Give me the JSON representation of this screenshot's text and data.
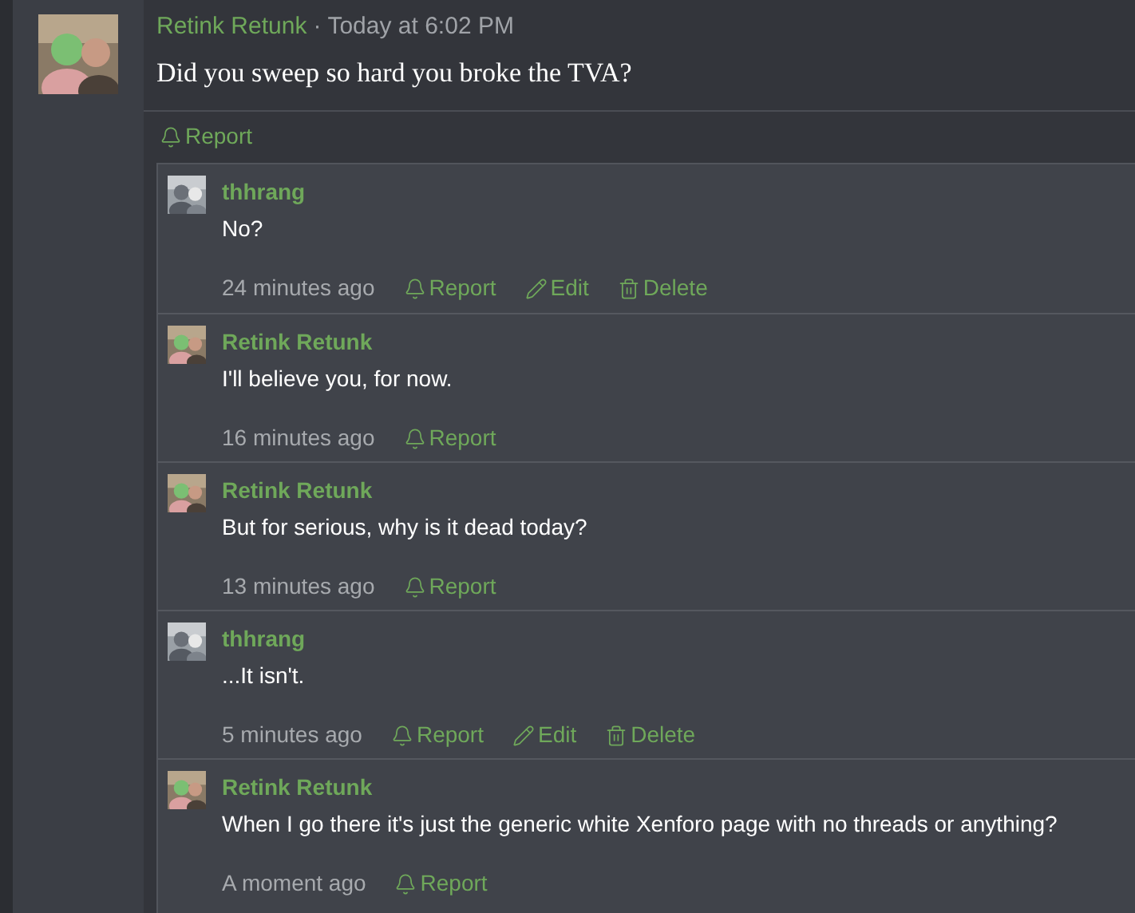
{
  "post": {
    "author": "Retink Retunk",
    "separator": "·",
    "time": "Today at 6:02 PM",
    "body": "Did you sweep so hard you broke the TVA?",
    "actions": [
      {
        "kind": "report",
        "label": "Report"
      }
    ]
  },
  "comments": [
    {
      "author": "thhrang",
      "body": "No?",
      "time": "24 minutes ago",
      "actions": [
        {
          "kind": "report",
          "label": "Report"
        },
        {
          "kind": "edit",
          "label": "Edit"
        },
        {
          "kind": "delete",
          "label": "Delete"
        }
      ]
    },
    {
      "author": "Retink Retunk",
      "body": "I'll believe you, for now.",
      "time": "16 minutes ago",
      "actions": [
        {
          "kind": "report",
          "label": "Report"
        }
      ]
    },
    {
      "author": "Retink Retunk",
      "body": "But for serious, why is it dead today?",
      "time": "13 minutes ago",
      "actions": [
        {
          "kind": "report",
          "label": "Report"
        }
      ]
    },
    {
      "author": "thhrang",
      "body": "...It isn't.",
      "time": "5 minutes ago",
      "actions": [
        {
          "kind": "report",
          "label": "Report"
        },
        {
          "kind": "edit",
          "label": "Edit"
        },
        {
          "kind": "delete",
          "label": "Delete"
        }
      ]
    },
    {
      "author": "Retink Retunk",
      "body": "When I go there it's just the generic white Xenforo page with no threads or anything?",
      "time": "A moment ago",
      "actions": [
        {
          "kind": "report",
          "label": "Report"
        }
      ]
    }
  ]
}
